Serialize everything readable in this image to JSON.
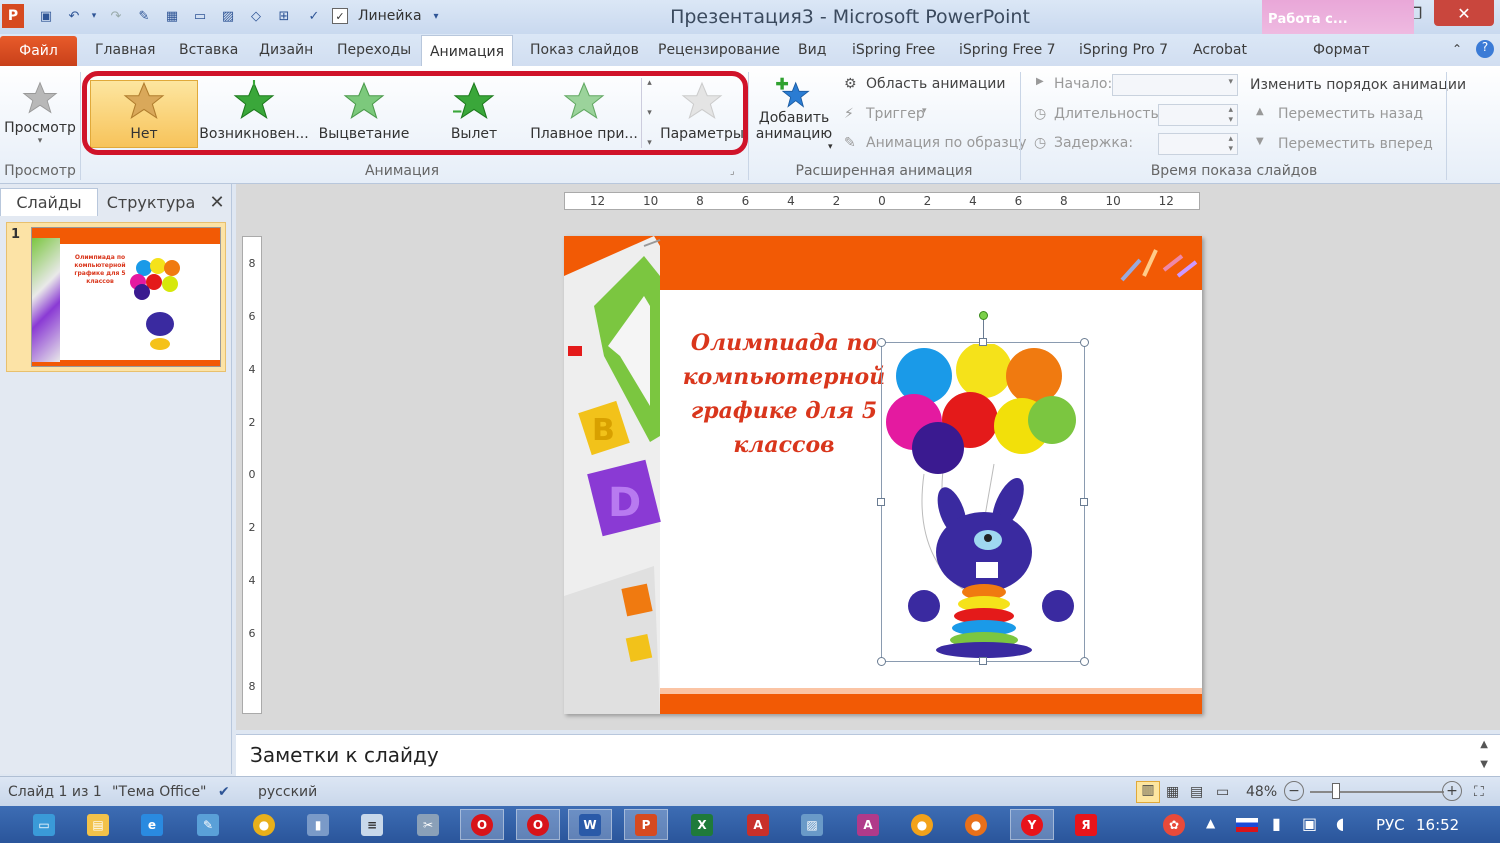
{
  "window": {
    "title": "Презентация3  -  Microsoft PowerPoint",
    "context_tab_group": "Работа с...",
    "qat_ruler_label": "Линейка"
  },
  "tabs": [
    {
      "label": "Файл"
    },
    {
      "label": "Главная"
    },
    {
      "label": "Вставка"
    },
    {
      "label": "Дизайн"
    },
    {
      "label": "Переходы"
    },
    {
      "label": "Анимация"
    },
    {
      "label": "Показ слайдов"
    },
    {
      "label": "Рецензирование"
    },
    {
      "label": "Вид"
    },
    {
      "label": "iSpring Free"
    },
    {
      "label": "iSpring Free 7"
    },
    {
      "label": "iSpring Pro 7"
    },
    {
      "label": "Acrobat"
    },
    {
      "label": "Формат"
    }
  ],
  "ribbon": {
    "preview": {
      "button": "Просмотр",
      "group": "Просмотр"
    },
    "animation": {
      "group": "Анимация",
      "gallery": [
        {
          "label": "Нет"
        },
        {
          "label": "Возникновен..."
        },
        {
          "label": "Выцветание"
        },
        {
          "label": "Вылет"
        },
        {
          "label": "Плавное при..."
        }
      ],
      "params": "Параметры"
    },
    "advanced": {
      "group": "Расширенная анимация",
      "add_line1": "Добавить",
      "add_line2": "анимацию",
      "pane": "Область анимации",
      "trigger": "Триггер",
      "painter": "Анимация по образцу"
    },
    "timing": {
      "group": "Время показа слайдов",
      "start": "Начало:",
      "duration": "Длительность:",
      "delay": "Задержка:",
      "reorder": "Изменить порядок анимации",
      "move_back": "Переместить назад",
      "move_fwd": "Переместить вперед"
    }
  },
  "panel": {
    "tab_slides": "Слайды",
    "tab_outline": "Структура",
    "slide_num": "1"
  },
  "ruler_ticks": [
    "12",
    "10",
    "8",
    "6",
    "4",
    "2",
    "0",
    "2",
    "4",
    "6",
    "8",
    "10",
    "12"
  ],
  "vruler_ticks": [
    "8",
    "6",
    "4",
    "2",
    "0",
    "2",
    "4",
    "6",
    "8"
  ],
  "slide": {
    "title": "Олимпиада по компьютерной графике для 5 классов"
  },
  "notes": {
    "placeholder": "Заметки к слайду"
  },
  "status": {
    "slide": "Слайд 1 из 1",
    "theme": "\"Тема Office\"",
    "lang": "русский",
    "zoom": "48%"
  },
  "taskbar": {
    "lang": "РУС",
    "time": "16:52"
  },
  "colors": {
    "accent_file": "#d64a20",
    "selection": "#f7c35a",
    "highlight_frame": "#d0132a",
    "slide_orange": "#f25a05",
    "title_red": "#d9361c"
  }
}
